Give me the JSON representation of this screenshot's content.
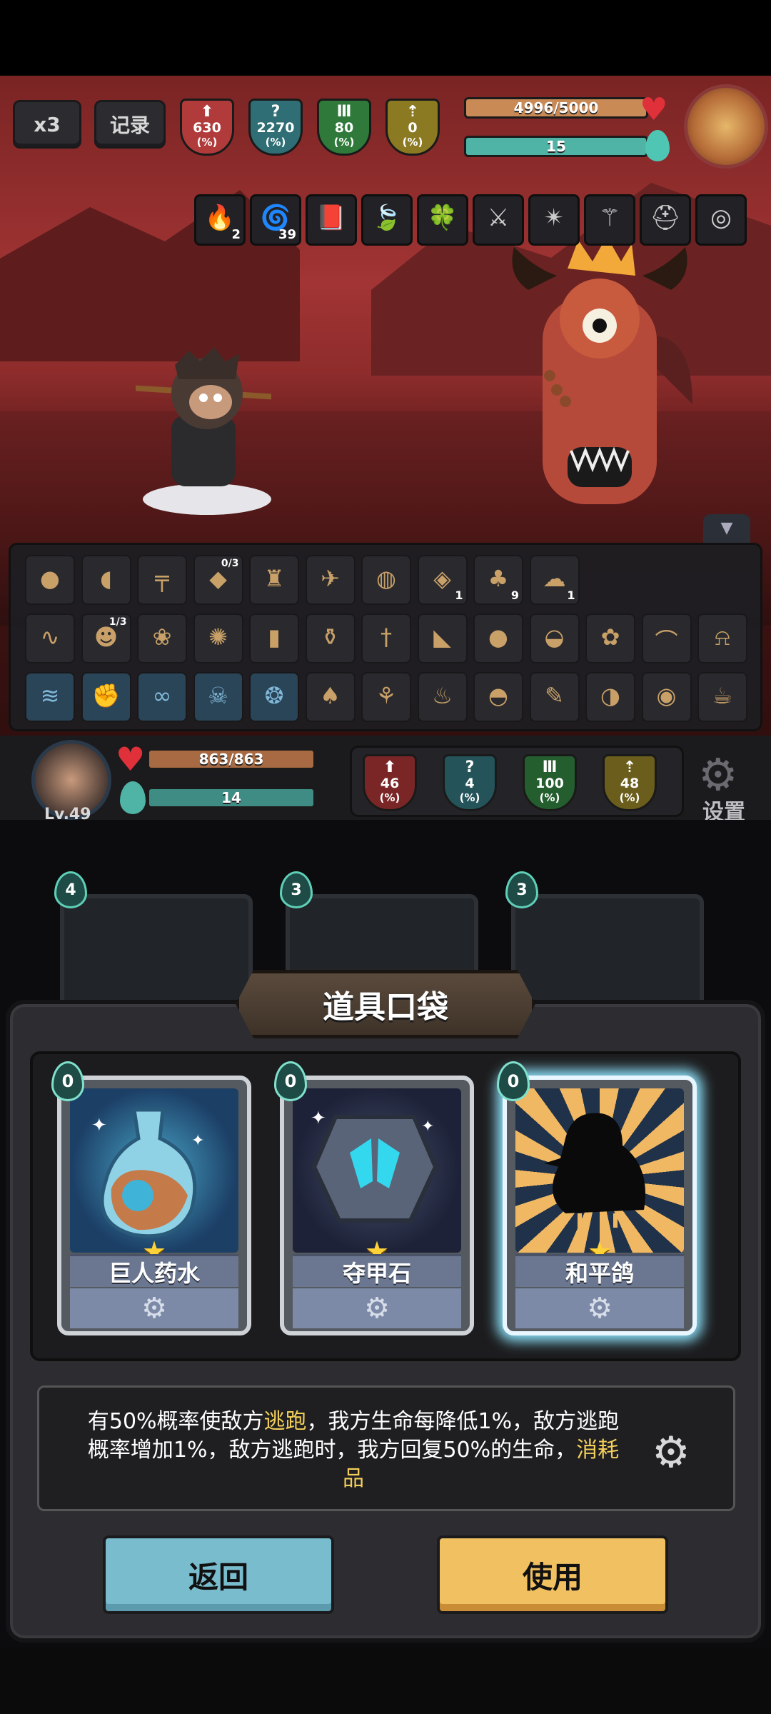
{
  "top": {
    "speed_label": "x3",
    "record_label": "记录",
    "enemy_stats": [
      {
        "value": "630",
        "unit": "(%)",
        "color": "#b13b3b",
        "icon": "attack-arrow-icon"
      },
      {
        "value": "2270",
        "unit": "(%)",
        "color": "#2f6e74",
        "icon": "crit-question-icon"
      },
      {
        "value": "80",
        "unit": "(%)",
        "color": "#2f7a3a",
        "icon": "defense-pillar-icon"
      },
      {
        "value": "0",
        "unit": "(%)",
        "color": "#8b7a22",
        "icon": "speed-up-icon"
      }
    ],
    "enemy_hp": {
      "text": "4996/5000",
      "fill": 0.999,
      "color": "#c98a56"
    },
    "enemy_mana": {
      "text": "15",
      "fill": 1.0,
      "color": "#4fb3a6"
    }
  },
  "relics": [
    {
      "count": "2",
      "icon": "fire-imp-icon"
    },
    {
      "count": "39",
      "icon": "spiral-shell-icon"
    },
    {
      "count": "",
      "icon": "book-icon"
    },
    {
      "count": "",
      "icon": "green-leaf-icon"
    },
    {
      "count": "",
      "icon": "lime-leaf-icon"
    },
    {
      "count": "",
      "icon": "warrior-icon"
    },
    {
      "count": "",
      "icon": "flame-claw-icon"
    },
    {
      "count": "",
      "icon": "red-trident-icon"
    },
    {
      "count": "",
      "icon": "dark-helmet-icon"
    },
    {
      "count": "",
      "icon": "bead-necklace-icon"
    }
  ],
  "inventory": {
    "row1": [
      {
        "icon": "seed-icon",
        "count": ""
      },
      {
        "icon": "boot-icon",
        "count": ""
      },
      {
        "icon": "gun-icon",
        "count": ""
      },
      {
        "icon": "red-cape-icon",
        "count": "",
        "top": "0/3"
      },
      {
        "icon": "gold-trophy-icon",
        "count": ""
      },
      {
        "icon": "bird-icon",
        "count": ""
      },
      {
        "icon": "egg-nest-icon",
        "count": ""
      },
      {
        "icon": "blue-shield-icon",
        "count": "1"
      },
      {
        "icon": "green-pear-icon",
        "count": "9"
      },
      {
        "icon": "smoke-icon",
        "count": "1"
      }
    ],
    "row2": [
      {
        "icon": "rope-icon",
        "count": ""
      },
      {
        "icon": "goblin-icon",
        "count": "",
        "top": "1/3"
      },
      {
        "icon": "berry-icon",
        "count": ""
      },
      {
        "icon": "coral-icon",
        "count": ""
      },
      {
        "icon": "dark-shard-icon",
        "count": ""
      },
      {
        "icon": "skull-jar-icon",
        "count": ""
      },
      {
        "icon": "dagger-icon",
        "count": ""
      },
      {
        "icon": "fang-icon",
        "count": ""
      },
      {
        "icon": "coconut-icon",
        "count": ""
      },
      {
        "icon": "bag-icon",
        "count": ""
      },
      {
        "icon": "red-bow-icon",
        "count": ""
      },
      {
        "icon": "golden-horn-icon",
        "count": ""
      },
      {
        "icon": "brown-bell-icon",
        "count": ""
      }
    ],
    "row3": [
      {
        "icon": "blue-rune-1-icon",
        "count": ""
      },
      {
        "icon": "blue-rune-2-icon",
        "count": ""
      },
      {
        "icon": "blue-rune-3-icon",
        "count": ""
      },
      {
        "icon": "blue-skull-icon",
        "count": ""
      },
      {
        "icon": "blue-rune-4-icon",
        "count": ""
      },
      {
        "icon": "parrot-icon",
        "count": ""
      },
      {
        "icon": "sword-leaf-icon",
        "count": ""
      },
      {
        "icon": "fire-pot-icon",
        "count": ""
      },
      {
        "icon": "black-pot-icon",
        "count": ""
      },
      {
        "icon": "brush-icon",
        "count": ""
      },
      {
        "icon": "pink-shell-icon",
        "count": ""
      },
      {
        "icon": "pouch-icon",
        "count": ""
      },
      {
        "icon": "teacup-icon",
        "count": ""
      }
    ]
  },
  "player": {
    "level": "Lv.49",
    "hp_text": "863/863",
    "hp_fill": 1.0,
    "mana_text": "14",
    "mana_fill": 1.0,
    "stats": [
      {
        "value": "46",
        "unit": "(%)",
        "color": "#7a2626",
        "icon": "attack-arrow-icon"
      },
      {
        "value": "4",
        "unit": "(%)",
        "color": "#24545a",
        "icon": "crit-question-icon"
      },
      {
        "value": "100",
        "unit": "(%)",
        "color": "#255e2e",
        "icon": "defense-pillar-icon"
      },
      {
        "value": "48",
        "unit": "(%)",
        "color": "#6b5e1c",
        "icon": "speed-up-icon"
      }
    ],
    "settings_label": "设置"
  },
  "hand_cards": [
    {
      "cost": "4"
    },
    {
      "cost": "3"
    },
    {
      "cost": "3"
    }
  ],
  "modal": {
    "title": "道具口袋",
    "cards": [
      {
        "cost": "0",
        "name": "巨人药水",
        "icon": "giant-potion-icon",
        "selected": false
      },
      {
        "cost": "0",
        "name": "夺甲石",
        "icon": "armor-steal-stone-icon",
        "selected": false
      },
      {
        "cost": "0",
        "name": "和平鸽",
        "icon": "peace-dove-icon",
        "selected": true
      }
    ],
    "description": {
      "p1": "有50%概率使敌方",
      "hl1": "逃跑",
      "p2": "，我方生命每降低1%，敌方逃跑概率增加1%，敌方逃跑时，我方回复50%的生命，",
      "hl2": "消耗品"
    },
    "back_label": "返回",
    "use_label": "使用"
  }
}
